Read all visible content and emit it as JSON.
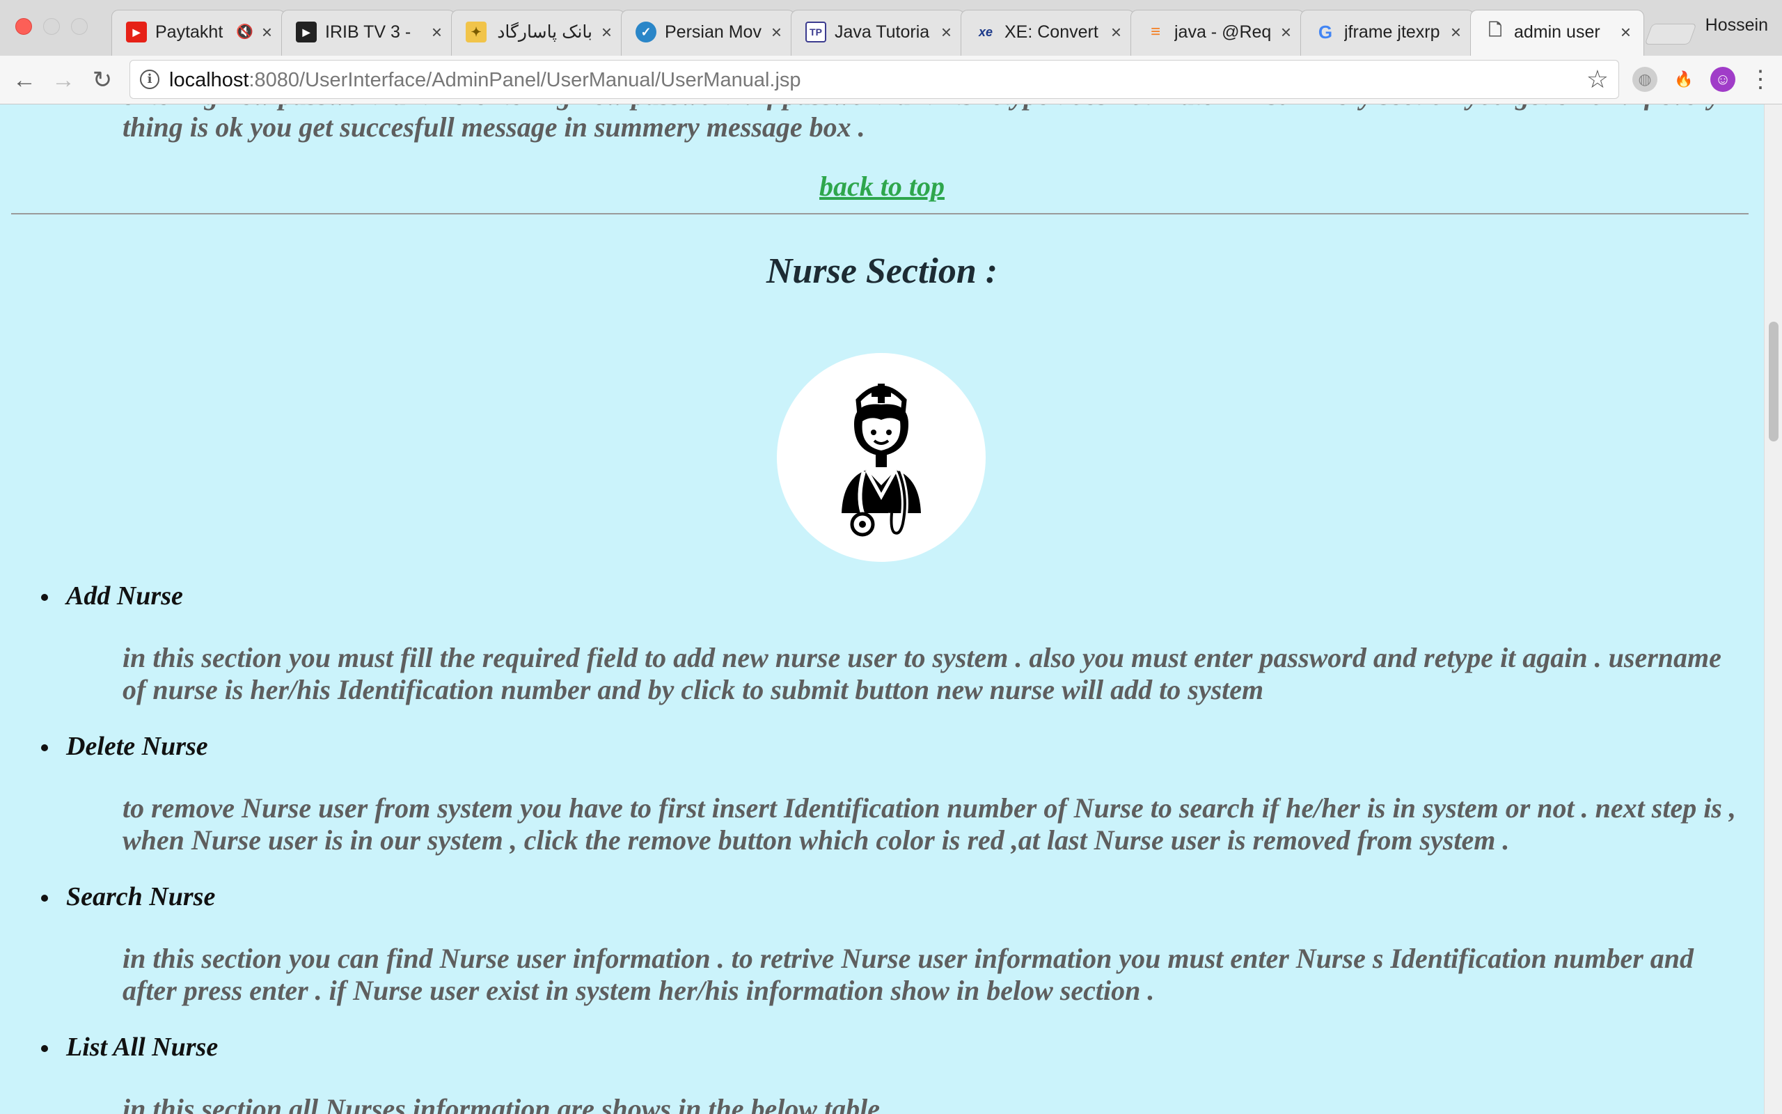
{
  "browser": {
    "tabs": [
      {
        "title": "Paytakht",
        "favicon": "youtube-icon",
        "muted": true
      },
      {
        "title": "IRIB TV 3 - ",
        "favicon": "play-icon"
      },
      {
        "title": "بانک پاسارگاد :: ",
        "favicon": "bank-icon"
      },
      {
        "title": "Persian Mov",
        "favicon": "persian-movies-icon"
      },
      {
        "title": "Java Tutoria",
        "favicon": "tutorial-icon"
      },
      {
        "title": "XE: Convert",
        "favicon": "xe-icon"
      },
      {
        "title": "java - @Req",
        "favicon": "stackoverflow-icon"
      },
      {
        "title": "jframe jtexrp",
        "favicon": "google-icon"
      },
      {
        "title": "admin user ",
        "favicon": "page-icon",
        "active": true
      }
    ],
    "profile_name": "Hossein",
    "url_host": "localhost",
    "url_rest": ":8080/UserInterface/AdminPanel/UserManual/UserManual.jsp"
  },
  "page": {
    "previous_tail_line1": "entering new password and re-entering new password . if password and its retype does not match in summery section you get error . if every",
    "previous_tail_line2": "thing is ok you get succesfull message in summery message box .",
    "back_to_top": "back to top",
    "section_title": "Nurse Section :",
    "items": [
      {
        "title": "Add Nurse",
        "desc": "in this section you must fill the required field to add new nurse user to system . also you must enter password and retype it again . username of nurse is her/his Identification number and by click to submit button new nurse will add to system"
      },
      {
        "title": "Delete Nurse",
        "desc": "to remove Nurse user from system you have to first insert Identification number of Nurse to search if he/her is in system or not . next step is , when Nurse user is in our system , click the remove button which color is red ,at last Nurse user is removed from system ."
      },
      {
        "title": "Search Nurse",
        "desc": "in this section you can find Nurse user information . to retrive Nurse user information you must enter Nurse s Identification number and after press enter . if Nurse user exist in system her/his information show in below section ."
      },
      {
        "title": "List All Nurse",
        "desc": "in this section all Nurses information are shows in the below table"
      }
    ]
  },
  "colors": {
    "page_bg": "#cbf3fb",
    "link": "#2ea64c",
    "text": "#5e5e5e"
  }
}
